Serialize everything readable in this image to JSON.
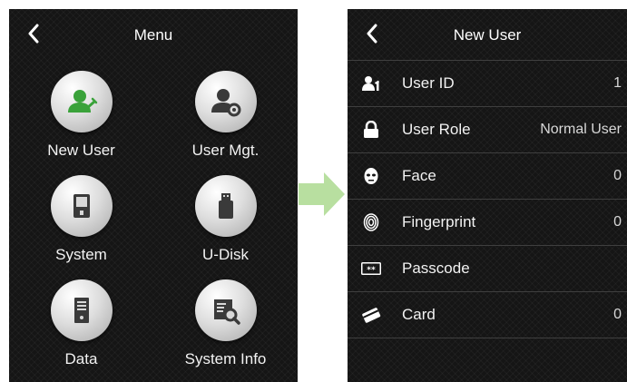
{
  "menu_screen": {
    "title": "Menu",
    "items": [
      {
        "label": "New User",
        "icon": "new-user-icon"
      },
      {
        "label": "User Mgt.",
        "icon": "user-mgt-icon"
      },
      {
        "label": "System",
        "icon": "system-icon"
      },
      {
        "label": "U-Disk",
        "icon": "u-disk-icon"
      },
      {
        "label": "Data",
        "icon": "data-icon"
      },
      {
        "label": "System Info",
        "icon": "system-info-icon"
      }
    ]
  },
  "new_user_screen": {
    "title": "New User",
    "rows": [
      {
        "label": "User ID",
        "value": "1",
        "icon": "user-id-icon"
      },
      {
        "label": "User Role",
        "value": "Normal User",
        "icon": "lock-icon"
      },
      {
        "label": "Face",
        "value": "0",
        "icon": "face-icon"
      },
      {
        "label": "Fingerprint",
        "value": "0",
        "icon": "fingerprint-icon"
      },
      {
        "label": "Passcode",
        "value": "",
        "icon": "passcode-icon"
      },
      {
        "label": "Card",
        "value": "0",
        "icon": "card-icon"
      }
    ]
  },
  "colors": {
    "screen_bg": "#151515",
    "arrow": "#b8dfa0",
    "new_user_accent": "#3aa23a",
    "icon_dark": "#3a3a3a"
  }
}
